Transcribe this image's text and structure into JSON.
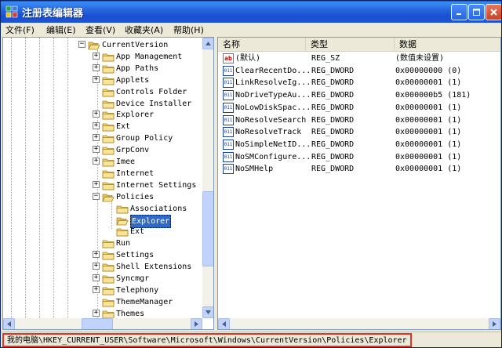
{
  "window": {
    "title": "注册表编辑器"
  },
  "menu": [
    {
      "label": "文件(F)"
    },
    {
      "label": "编辑(E)"
    },
    {
      "label": "查看(V)"
    },
    {
      "label": "收藏夹(A)"
    },
    {
      "label": "帮助(H)"
    }
  ],
  "tree": {
    "root": {
      "label": "CurrentVersion",
      "expanded": true
    },
    "items": [
      {
        "label": "App Management",
        "expandable": true
      },
      {
        "label": "App Paths",
        "expandable": true
      },
      {
        "label": "Applets",
        "expandable": true
      },
      {
        "label": "Controls Folder",
        "expandable": false
      },
      {
        "label": "Device Installer",
        "expandable": false
      },
      {
        "label": "Explorer",
        "expandable": true
      },
      {
        "label": "Ext",
        "expandable": true
      },
      {
        "label": "Group Policy",
        "expandable": true
      },
      {
        "label": "GrpConv",
        "expandable": true
      },
      {
        "label": "Imee",
        "expandable": true
      },
      {
        "label": "Internet",
        "expandable": false
      },
      {
        "label": "Internet Settings",
        "expandable": true
      },
      {
        "label": "Policies",
        "expandable": true,
        "expanded": true
      },
      {
        "label": "Run",
        "expandable": false
      },
      {
        "label": "Settings",
        "expandable": true
      },
      {
        "label": "Shell Extensions",
        "expandable": true
      },
      {
        "label": "Syncmgr",
        "expandable": true
      },
      {
        "label": "Telephony",
        "expandable": true
      },
      {
        "label": "ThemeManager",
        "expandable": false
      },
      {
        "label": "Themes",
        "expandable": true
      }
    ],
    "policies_children": [
      {
        "label": "Associations",
        "selected": false
      },
      {
        "label": "Explorer",
        "selected": true
      },
      {
        "label": "Ext",
        "selected": false
      }
    ]
  },
  "list": {
    "columns": [
      {
        "label": "名称"
      },
      {
        "label": "类型"
      },
      {
        "label": "数据"
      }
    ],
    "rows": [
      {
        "name": "(默认)",
        "type": "REG_SZ",
        "data": "(数值未设置)",
        "icon": "string-value-icon"
      },
      {
        "name": "ClearRecentDo...",
        "type": "REG_DWORD",
        "data": "0x00000000 (0)",
        "icon": "dword-value-icon"
      },
      {
        "name": "LinkResolveIg...",
        "type": "REG_DWORD",
        "data": "0x00000001 (1)",
        "icon": "dword-value-icon"
      },
      {
        "name": "NoDriveTypeAu...",
        "type": "REG_DWORD",
        "data": "0x000000b5 (181)",
        "icon": "dword-value-icon"
      },
      {
        "name": "NoLowDiskSpac...",
        "type": "REG_DWORD",
        "data": "0x00000001 (1)",
        "icon": "dword-value-icon"
      },
      {
        "name": "NoResolveSearch",
        "type": "REG_DWORD",
        "data": "0x00000001 (1)",
        "icon": "dword-value-icon"
      },
      {
        "name": "NoResolveTrack",
        "type": "REG_DWORD",
        "data": "0x00000001 (1)",
        "icon": "dword-value-icon"
      },
      {
        "name": "NoSimpleNetID...",
        "type": "REG_DWORD",
        "data": "0x00000001 (1)",
        "icon": "dword-value-icon"
      },
      {
        "name": "NoSMConfigure...",
        "type": "REG_DWORD",
        "data": "0x00000001 (1)",
        "icon": "dword-value-icon"
      },
      {
        "name": "NoSMHelp",
        "type": "REG_DWORD",
        "data": "0x00000001 (1)",
        "icon": "dword-value-icon"
      }
    ]
  },
  "status": {
    "path": "我的电脑\\HKEY_CURRENT_USER\\Software\\Microsoft\\Windows\\CurrentVersion\\Policies\\Explorer"
  },
  "colors": {
    "title_bar": "#2667e0",
    "selection": "#316ac5",
    "status_highlight": "#e0352b"
  }
}
